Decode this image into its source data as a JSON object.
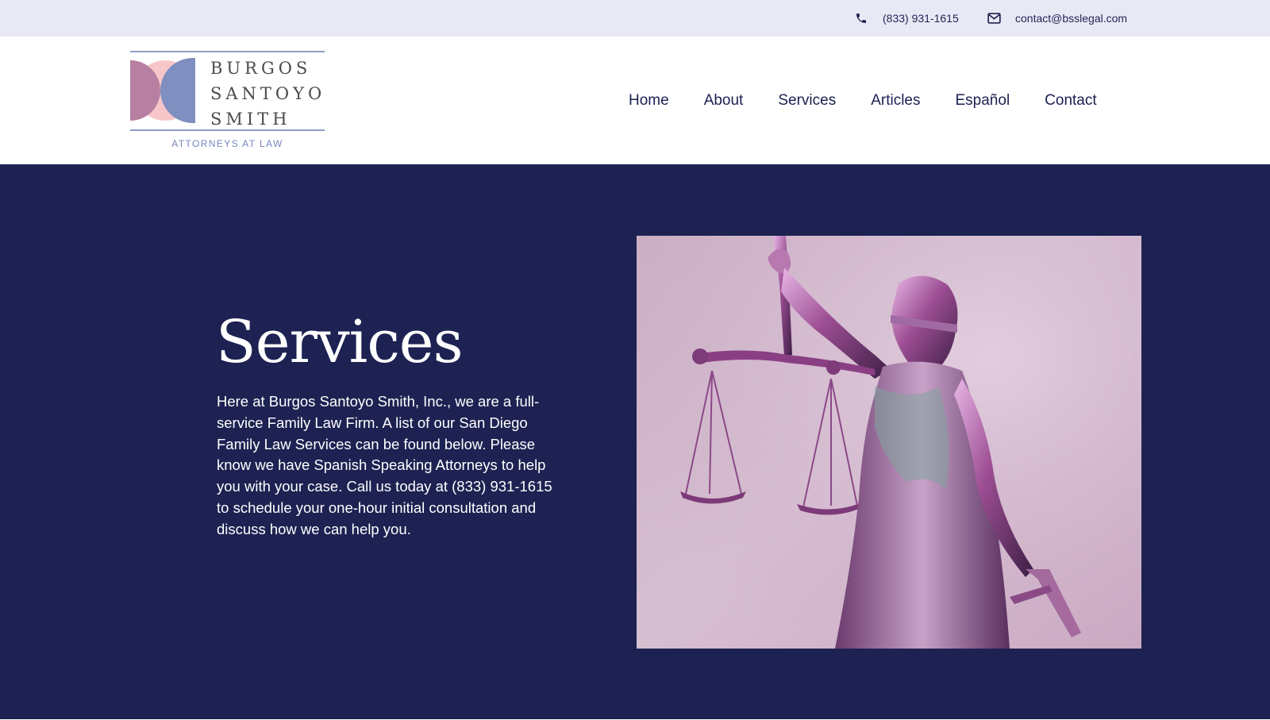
{
  "topbar": {
    "phone": {
      "icon": "phone-icon",
      "text": "(833) 931-1615"
    },
    "email": {
      "icon": "envelope-icon",
      "text": "contact@bsslegal.com"
    }
  },
  "logo": {
    "line1": "BURGOS",
    "line2": "SANTOYO",
    "line3": "SMITH",
    "tagline": "ATTORNEYS AT LAW",
    "colors": {
      "mauve": "#b77fa2",
      "pink": "#f7c6c8",
      "periwinkle": "#7f8fc0",
      "rule": "#8f9bc7"
    }
  },
  "nav": {
    "items": [
      {
        "label": "Home"
      },
      {
        "label": "About"
      },
      {
        "label": "Services"
      },
      {
        "label": "Articles"
      },
      {
        "label": "Español"
      },
      {
        "label": "Contact"
      }
    ]
  },
  "hero": {
    "title": "Services",
    "body": "Here at Burgos Santoyo Smith, Inc., we are a full-service Family Law Firm. A list of our San Diego Family Law Services can be found below. Please know we have Spanish Speaking Attorneys to help you with your case. Call us today at (833) 931-1615 to schedule your one-hour initial consultation and discuss how we can help you.",
    "image": {
      "subject": "lady-justice-statue-image"
    },
    "background_color": "#1d2252"
  }
}
